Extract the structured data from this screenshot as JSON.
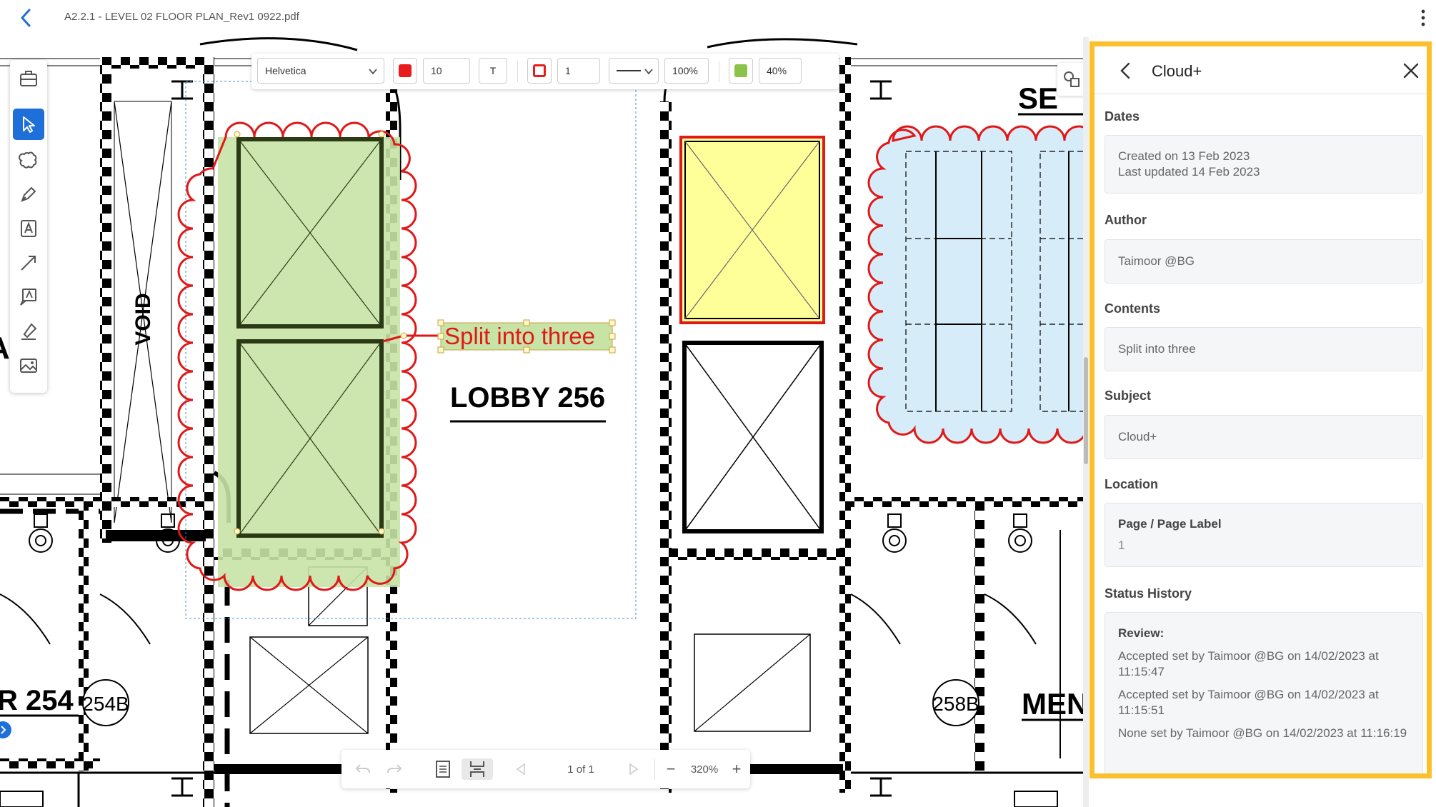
{
  "header": {
    "title": "A2.2.1 - LEVEL 02 FLOOR PLAN_Rev1 0922.pdf"
  },
  "format_toolbar": {
    "font": "Helvetica",
    "font_size": "10",
    "text_icon": "T",
    "stroke_width": "1",
    "stroke_opacity": "100%",
    "fill_opacity": "40%",
    "text_color": "#e81c1c",
    "stroke_color": "#e81c1c",
    "fill_color": "#8bc34a"
  },
  "drawing": {
    "annotation_text": "Split into three",
    "room_lobby": "LOBBY 256",
    "room_left": "R 254",
    "tag_254b": "254B",
    "tag_258b": "258B",
    "room_men": "MEN",
    "room_ser": "SE",
    "void": "VOID"
  },
  "bottom_bar": {
    "page": "1 of 1",
    "zoom": "320%"
  },
  "panel": {
    "title": "Cloud+",
    "dates_label": "Dates",
    "created": "Created on 13 Feb 2023",
    "updated": "Last updated 14 Feb 2023",
    "author_label": "Author",
    "author": "Taimoor @BG",
    "contents_label": "Contents",
    "contents": "Split into three",
    "subject_label": "Subject",
    "subject": "Cloud+",
    "location_label": "Location",
    "location_heading": "Page / Page Label",
    "location_value": "1",
    "status_label": "Status History",
    "review_heading": "Review:",
    "history": [
      "Accepted set by Taimoor @BG on 14/02/2023 at 11:15:47",
      "Accepted set by Taimoor @BG on 14/02/2023 at 11:15:51",
      "None set by Taimoor @BG on 14/02/2023 at 11:16:19"
    ]
  },
  "accent": "#fbc02d",
  "primary": "#1e6fd9"
}
